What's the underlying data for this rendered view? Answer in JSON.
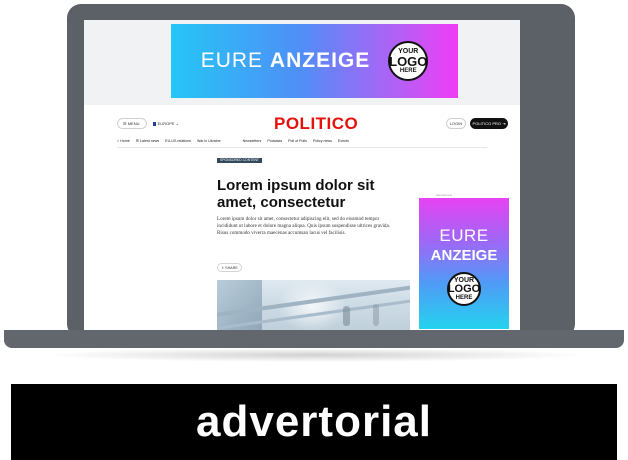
{
  "top_ad": {
    "text_light": "EURE",
    "text_bold": "ANZEIGE",
    "logo": [
      "YOUR",
      "LOGO",
      "HERE"
    ]
  },
  "header": {
    "menu_label": "☰ MENU",
    "region_label": "EUROPE ⌄",
    "brand": "POLITICO",
    "login_label": "LOGIN",
    "pro_label": "POLITICO PRO ⇥"
  },
  "nav": {
    "items": [
      "⌂ Home",
      "☰ Latest news",
      "EU-US relations",
      "War in Ukraine",
      "Newsletters",
      "Podcasts",
      "Poll of Polls",
      "Policy news",
      "Events"
    ]
  },
  "article": {
    "tag": "SPONSORED CONTENT",
    "headline": "Lorem ipsum dolor sit amet, consectetur",
    "body": "Lorem ipsum dolor sit amet, consectetur adipiscing elit, sed do eiusmod tempor incididunt ut labore et dolore magna aliqua. Quis ipsum suspendisse ultrices gravida. Risus commodo viverra maecenas accumsan lacus vel facilisis.",
    "share_label": "⇪ SHARE"
  },
  "side_ad": {
    "label": "Advertisement",
    "line1": "EURE",
    "line2": "ANZEIGE",
    "logo": [
      "YOUR",
      "LOGO",
      "HERE"
    ]
  },
  "caption": "advertorial",
  "colors": {
    "brand_red": "#e3120b",
    "ad_cyan": "#25c6f6",
    "ad_magenta": "#ef3df5",
    "laptop_gray": "#5c6168"
  }
}
